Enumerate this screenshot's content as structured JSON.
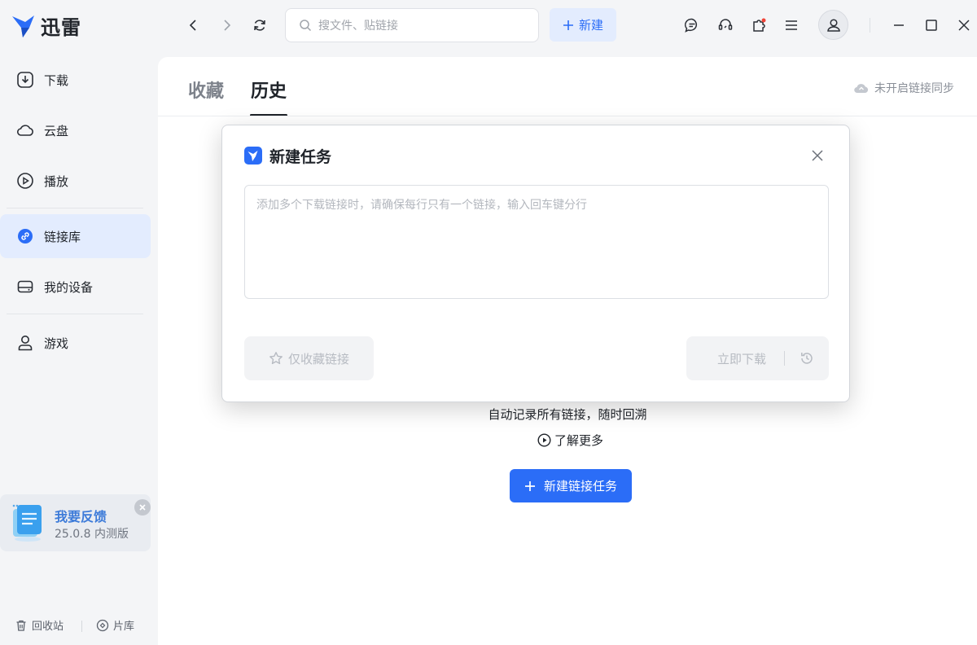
{
  "app": {
    "name": "迅雷",
    "brand_color": "#2b6df7"
  },
  "toolbar": {
    "search_placeholder": "搜文件、贴链接",
    "new_label": "新建",
    "icons": [
      "back-icon",
      "forward-icon",
      "refresh-icon",
      "message-icon",
      "headset-icon",
      "plugin-icon",
      "menu-icon",
      "user-icon",
      "minimize-icon",
      "maximize-icon",
      "close-icon"
    ]
  },
  "sidebar": {
    "items": [
      {
        "label": "下载",
        "icon": "download-icon"
      },
      {
        "label": "云盘",
        "icon": "cloud-icon"
      },
      {
        "label": "播放",
        "icon": "play-icon"
      },
      {
        "label": "链接库",
        "icon": "link-icon",
        "active": true
      },
      {
        "label": "我的设备",
        "icon": "device-icon"
      },
      {
        "label": "游戏",
        "icon": "game-icon"
      }
    ],
    "feedback": {
      "title": "我要反馈",
      "version": "25.0.8 内测版"
    },
    "bottom": {
      "recycle": "回收站",
      "library": "片库"
    }
  },
  "main": {
    "tabs": [
      {
        "label": "收藏",
        "active": false
      },
      {
        "label": "历史",
        "active": true
      }
    ],
    "sync_status": "未开启链接同步",
    "empty_desc": "自动记录所有链接，随时回溯",
    "learn_more": "了解更多",
    "new_task_button": "新建链接任务"
  },
  "dialog": {
    "title": "新建任务",
    "textarea_placeholder": "添加多个下载链接时，请确保每行只有一个链接，输入回车键分行",
    "fav_only_button": "仅收藏链接",
    "download_now_button": "立即下载"
  }
}
